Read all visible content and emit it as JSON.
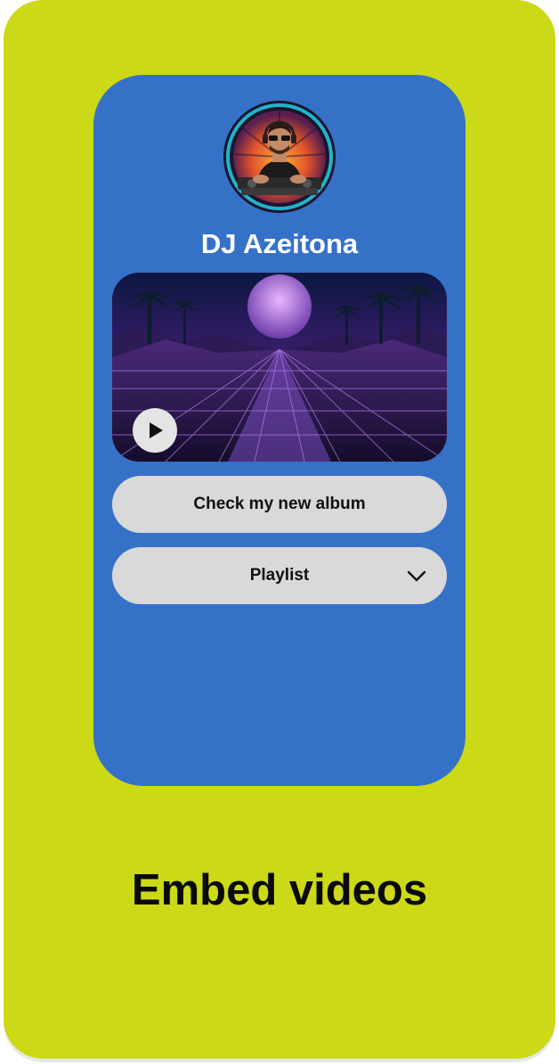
{
  "profile": {
    "name": "DJ Azeitona",
    "avatar_icon": "dj-portrait-icon"
  },
  "video": {
    "thumbnail_icon": "synthwave-landscape-icon",
    "play_icon": "play-icon"
  },
  "links": {
    "album_label": "Check my new album",
    "playlist_label": "Playlist",
    "playlist_icon": "chevron-down-icon"
  },
  "caption": "Embed videos",
  "colors": {
    "background": "#ccd916",
    "phone": "#3671c8",
    "button": "#d9d9d9",
    "text_dark": "#0a0a0a",
    "text_light": "#ffffff"
  }
}
